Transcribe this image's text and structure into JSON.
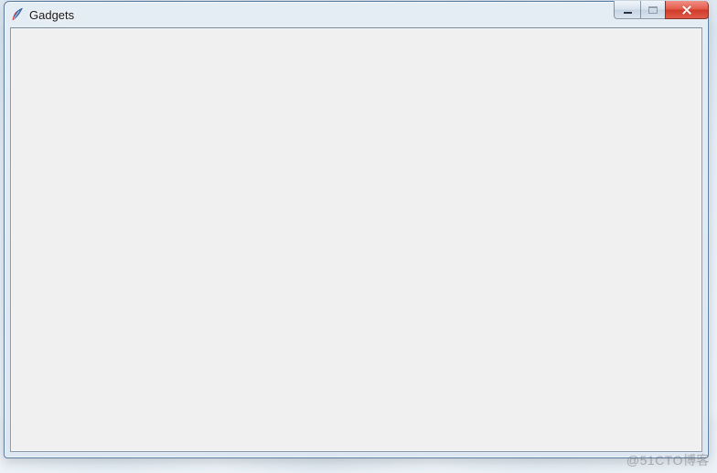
{
  "window": {
    "title": "Gadgets",
    "icon_name": "tk-feather-icon"
  },
  "controls": {
    "minimize": "minimize",
    "maximize": "maximize",
    "close": "close"
  },
  "watermark": "@51CTO博客"
}
